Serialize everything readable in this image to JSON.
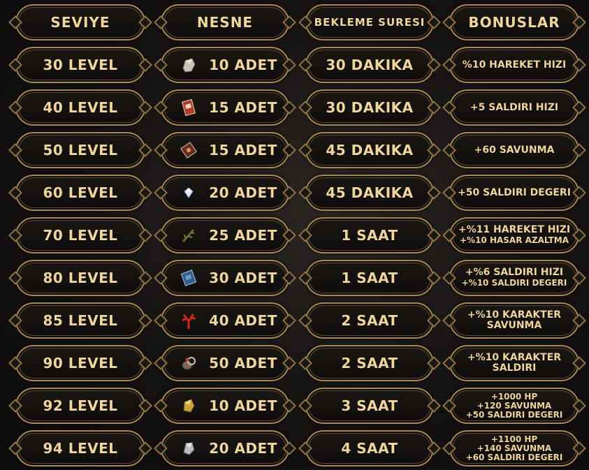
{
  "header": [
    "SEVIYE",
    "NESNE",
    "BEKLEME SURESI",
    "BONUSLAR"
  ],
  "rows": [
    {
      "level": "30 LEVEL",
      "item_icon": "stone-icon",
      "item": "10 ADET",
      "wait": "30 DAKIKA",
      "bonus": [
        "%10 HAREKET HIZI"
      ]
    },
    {
      "level": "40 LEVEL",
      "item_icon": "red-book-icon",
      "item": "15 ADET",
      "wait": "30 DAKIKA",
      "bonus": [
        "+5 SALDIRI HIZI"
      ]
    },
    {
      "level": "50 LEVEL",
      "item_icon": "brown-book-icon",
      "item": "15 ADET",
      "wait": "45 DAKIKA",
      "bonus": [
        "+60 SAVUNMA"
      ]
    },
    {
      "level": "60 LEVEL",
      "item_icon": "white-gem-icon",
      "item": "20 ADET",
      "wait": "45 DAKIKA",
      "bonus": [
        "+50 SALDIRI DEGERI"
      ]
    },
    {
      "level": "70 LEVEL",
      "item_icon": "branch-icon",
      "item": "25 ADET",
      "wait": "1 SAAT",
      "bonus": [
        "+%11 HAREKET HIZI",
        "+%10 HASAR AZALTMA"
      ]
    },
    {
      "level": "80 LEVEL",
      "item_icon": "blue-book-icon",
      "item": "30 ADET",
      "wait": "1 SAAT",
      "bonus": [
        "+%6 SALDIRI HIZI",
        "+%10 SALDIRI DEGERI"
      ]
    },
    {
      "level": "85 LEVEL",
      "item_icon": "red-coral-icon",
      "item": "40 ADET",
      "wait": "2 SAAT",
      "bonus": [
        "+%10 KARAKTER",
        "SAVUNMA"
      ]
    },
    {
      "level": "90 LEVEL",
      "item_icon": "ring-pouch-icon",
      "item": "50 ADET",
      "wait": "2 SAAT",
      "bonus": [
        "+%10 KARAKTER",
        "SALDIRI"
      ]
    },
    {
      "level": "92 LEVEL",
      "item_icon": "gold-stone-icon",
      "item": "10 ADET",
      "wait": "3 SAAT",
      "bonus": [
        "+1000 HP",
        "+120 SAVUNMA",
        "+50 SALDIRI DEGERI"
      ]
    },
    {
      "level": "94 LEVEL",
      "item_icon": "silver-stone-icon",
      "item": "20 ADET",
      "wait": "4 SAAT",
      "bonus": [
        "+1100 HP",
        "+140 SAVUNMA",
        "+60 SALDIRI DEGERI"
      ]
    }
  ]
}
